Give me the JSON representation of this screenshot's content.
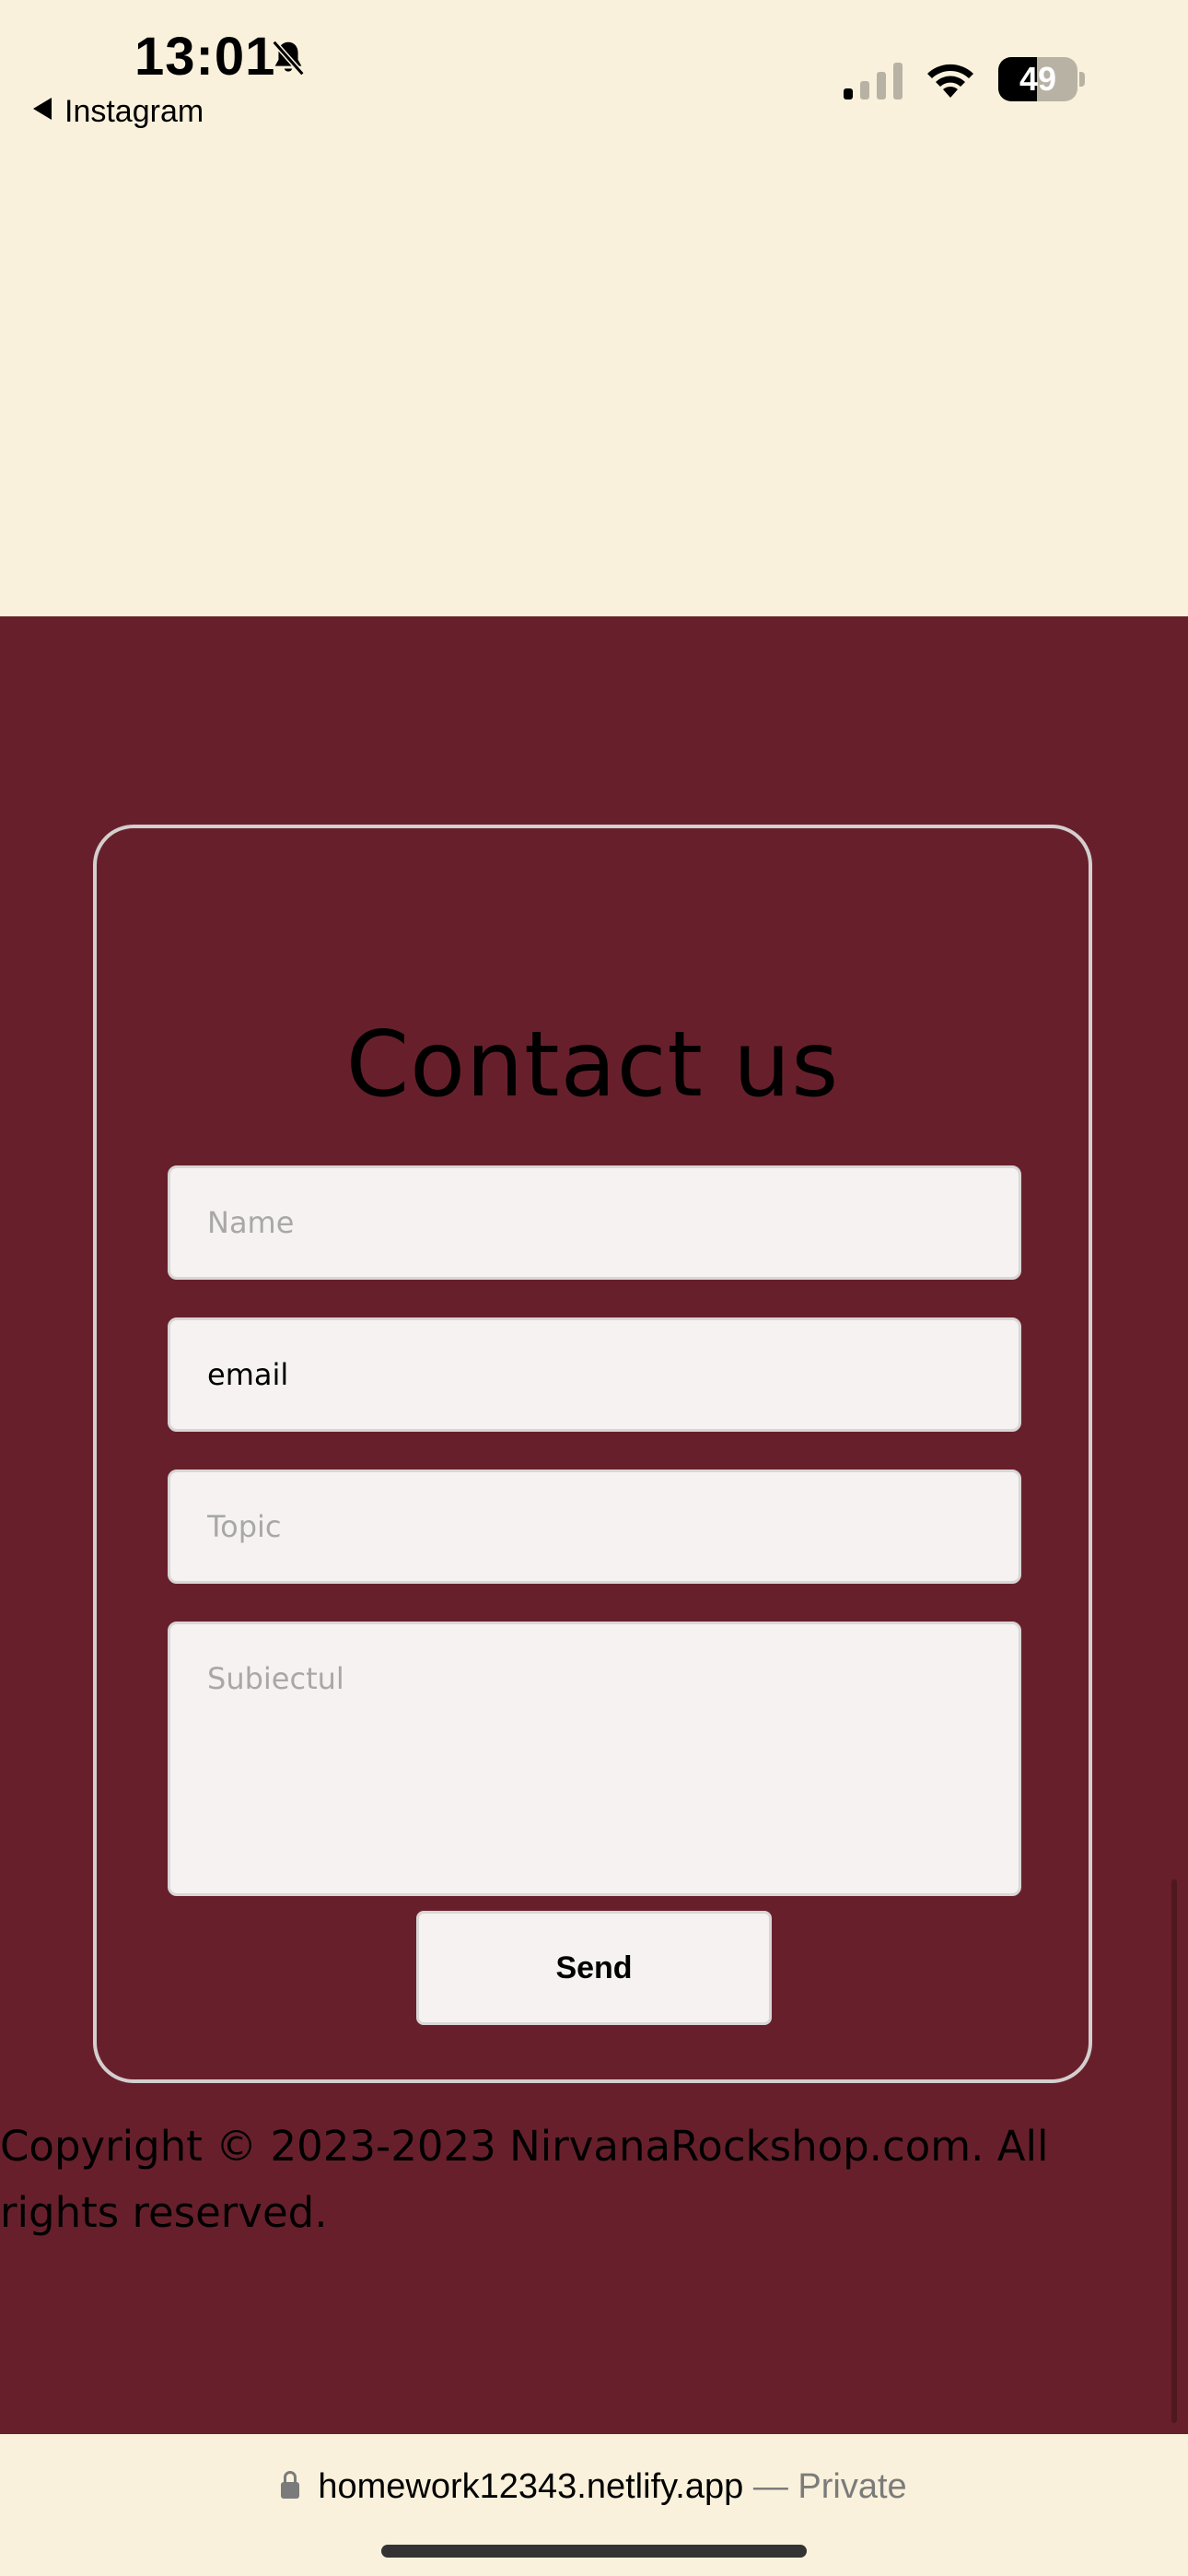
{
  "status_bar": {
    "time": "13:01",
    "back_label": "Instagram",
    "battery_level": "49",
    "icons": [
      "bell-slash-icon",
      "signal-icon",
      "wifi-icon",
      "battery-icon"
    ]
  },
  "contact": {
    "title": "Contact us",
    "name_placeholder": "Name",
    "email_value": "email",
    "topic_placeholder": "Topic",
    "message_placeholder": "Subiectul",
    "send_label": "Send"
  },
  "footer": {
    "copyright": "Copyright © 2023-2023 NirvanaRockshop.com. All rights reserved."
  },
  "browser": {
    "domain": "homework12343.netlify.app",
    "private_label": "— Private"
  },
  "colors": {
    "page_background": "#f9f1db",
    "section_background": "#67202b",
    "card_border": "#d4cfcf",
    "field_background": "#f6f2f2"
  }
}
